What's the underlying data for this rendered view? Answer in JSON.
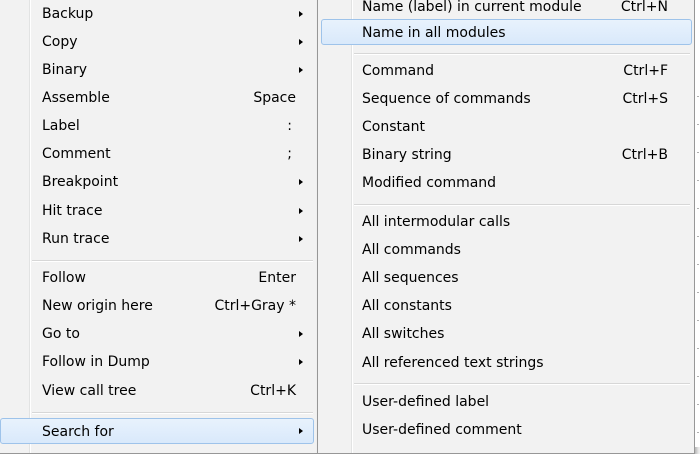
{
  "main_menu": {
    "items": [
      {
        "label": "Backup",
        "shortcut": "",
        "submenu": true
      },
      {
        "label": "Copy",
        "shortcut": "",
        "submenu": true
      },
      {
        "label": "Binary",
        "shortcut": "",
        "submenu": true
      },
      {
        "label": "Assemble",
        "shortcut": "Space",
        "submenu": false
      },
      {
        "label": "Label",
        "shortcut": ":",
        "submenu": false
      },
      {
        "label": "Comment",
        "shortcut": ";",
        "submenu": false
      },
      {
        "label": "Breakpoint",
        "shortcut": "",
        "submenu": true
      },
      {
        "label": "Hit trace",
        "shortcut": "",
        "submenu": true
      },
      {
        "label": "Run trace",
        "shortcut": "",
        "submenu": true
      },
      {
        "label": "Follow",
        "shortcut": "Enter",
        "submenu": false
      },
      {
        "label": "New origin here",
        "shortcut": "Ctrl+Gray *",
        "submenu": false
      },
      {
        "label": "Go to",
        "shortcut": "",
        "submenu": true
      },
      {
        "label": "Follow in Dump",
        "shortcut": "",
        "submenu": true
      },
      {
        "label": "View call tree",
        "shortcut": "Ctrl+K",
        "submenu": false
      },
      {
        "label": "Search for",
        "shortcut": "",
        "submenu": true,
        "highlighted": true
      }
    ]
  },
  "sub_menu": {
    "items": [
      {
        "label": "Name (label) in current module",
        "shortcut": "Ctrl+N"
      },
      {
        "label": "Name in all modules",
        "shortcut": "",
        "highlighted": true
      },
      {
        "label": "Command",
        "shortcut": "Ctrl+F"
      },
      {
        "label": "Sequence of commands",
        "shortcut": "Ctrl+S"
      },
      {
        "label": "Constant",
        "shortcut": ""
      },
      {
        "label": "Binary string",
        "shortcut": "Ctrl+B"
      },
      {
        "label": "Modified command",
        "shortcut": ""
      },
      {
        "label": "All intermodular calls",
        "shortcut": ""
      },
      {
        "label": "All commands",
        "shortcut": ""
      },
      {
        "label": "All sequences",
        "shortcut": ""
      },
      {
        "label": "All constants",
        "shortcut": ""
      },
      {
        "label": "All switches",
        "shortcut": ""
      },
      {
        "label": "All referenced text strings",
        "shortcut": ""
      },
      {
        "label": "User-defined label",
        "shortcut": ""
      },
      {
        "label": "User-defined comment",
        "shortcut": ""
      }
    ]
  }
}
